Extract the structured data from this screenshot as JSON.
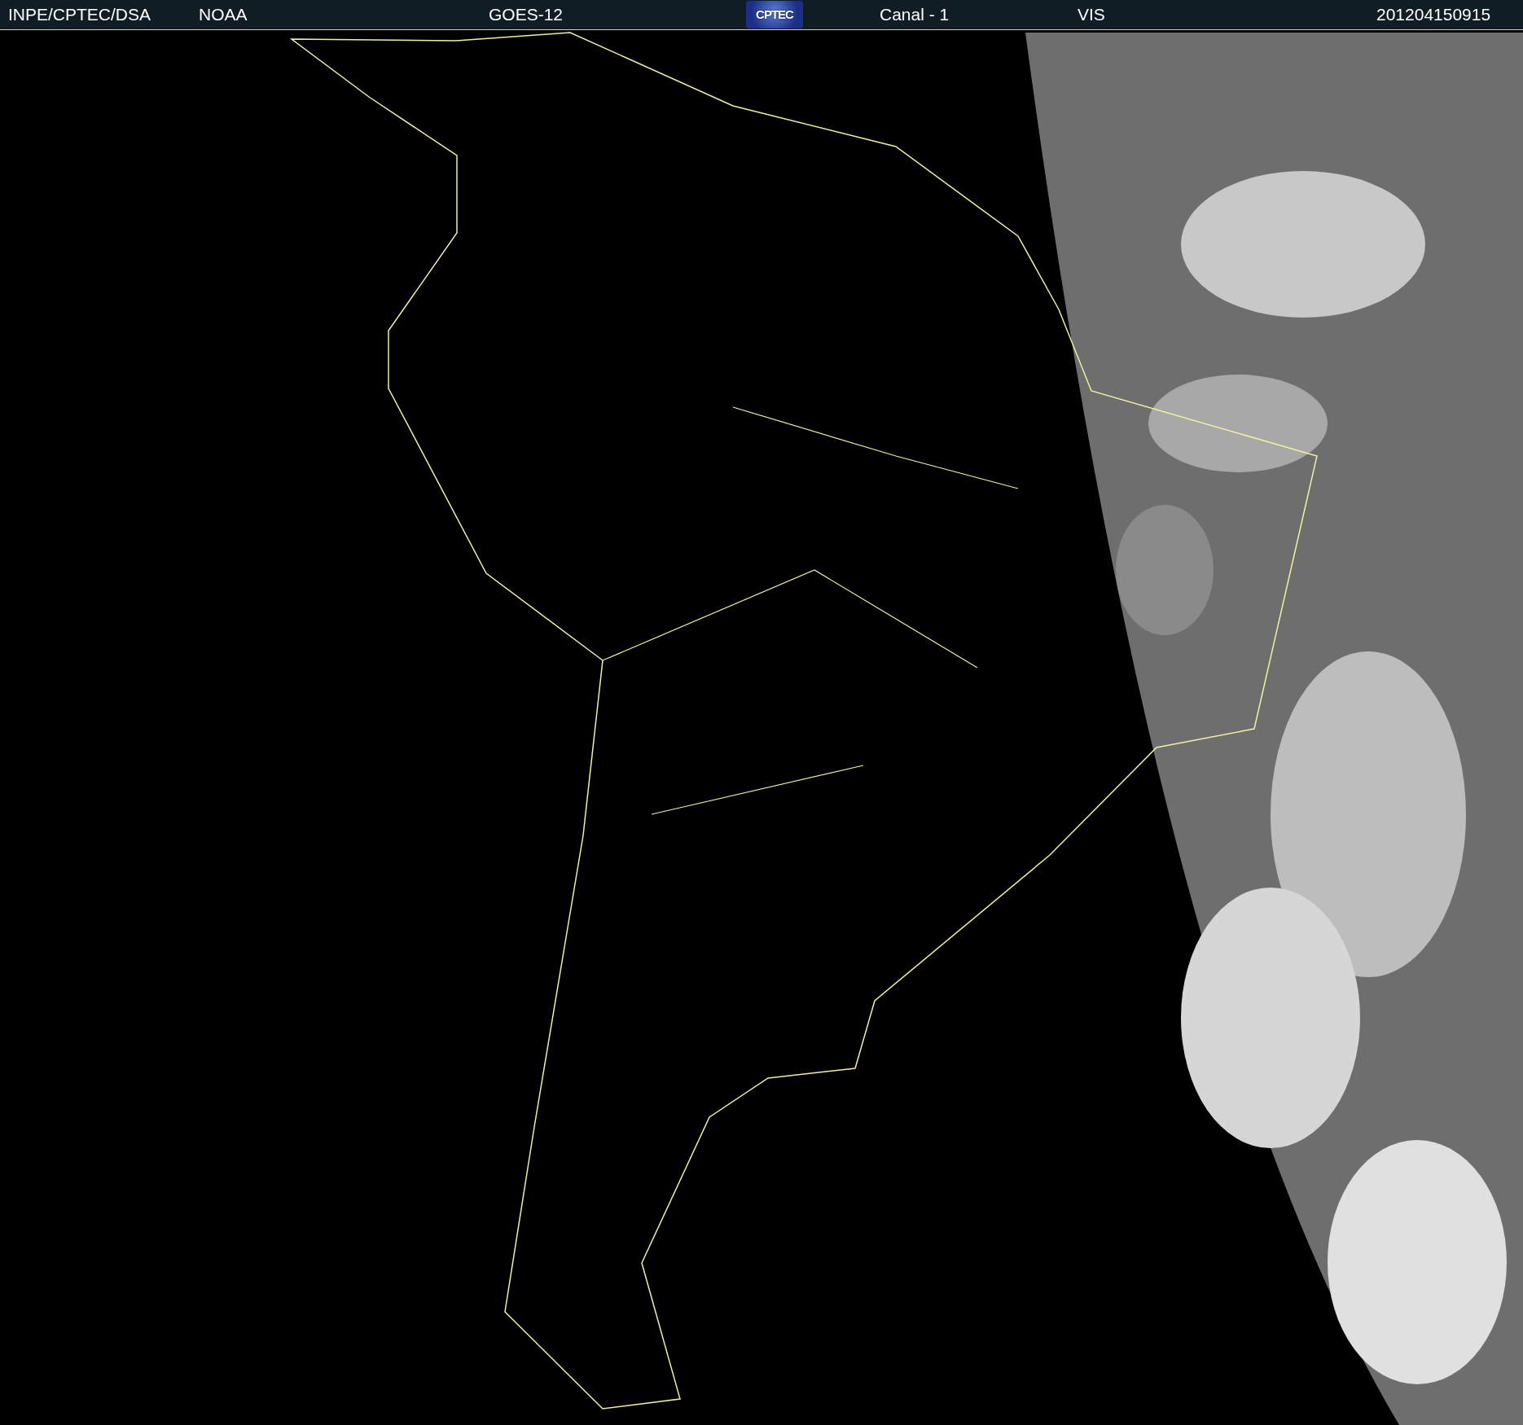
{
  "header": {
    "items": [
      {
        "kind": "text",
        "text": "INPE/CPTEC/DSA"
      },
      {
        "kind": "text",
        "text": "NOAA"
      },
      {
        "kind": "text",
        "text": "GOES-12"
      },
      {
        "kind": "logo",
        "text": "CPTEC"
      },
      {
        "kind": "text",
        "text": "Canal - 1"
      },
      {
        "kind": "text",
        "text": "VIS"
      },
      {
        "kind": "text",
        "text": "201204150915"
      }
    ]
  }
}
